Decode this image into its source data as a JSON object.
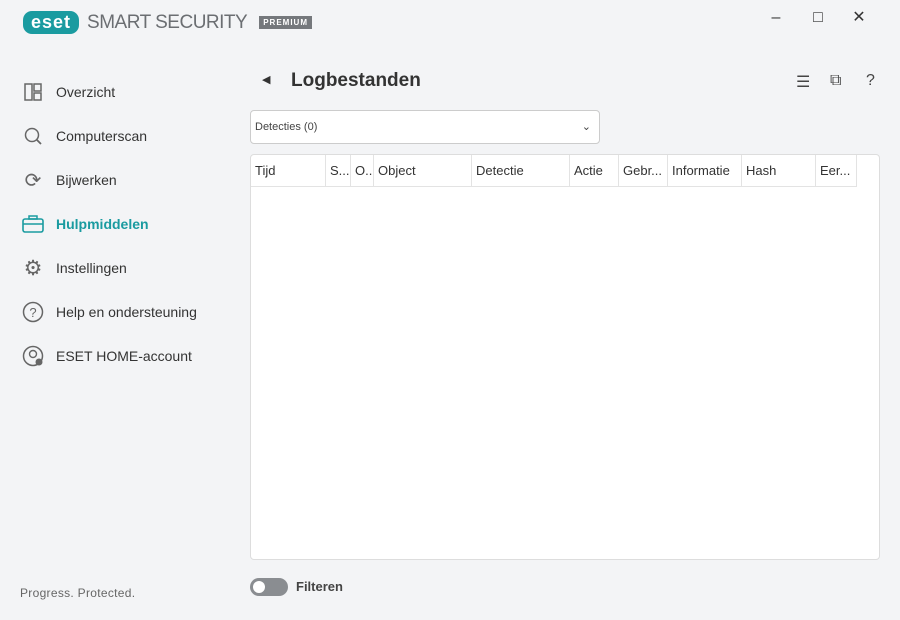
{
  "app": {
    "brand": "eset",
    "product": "SMART SECURITY",
    "edition": "PREMIUM",
    "tagline": "Progress. Protected."
  },
  "sidebar": {
    "items": [
      {
        "label": "Overzicht",
        "icon": "dashboard-icon"
      },
      {
        "label": "Computerscan",
        "icon": "search-icon"
      },
      {
        "label": "Bijwerken",
        "icon": "refresh-icon"
      },
      {
        "label": "Hulpmiddelen",
        "icon": "toolbox-icon",
        "active": true
      },
      {
        "label": "Instellingen",
        "icon": "gear-icon"
      },
      {
        "label": "Help en ondersteuning",
        "icon": "help-icon"
      },
      {
        "label": "ESET HOME-account",
        "icon": "account-icon"
      }
    ]
  },
  "page": {
    "title": "Logbestanden",
    "log_select": "Detecties (0)",
    "columns": [
      "Tijd",
      "S...",
      "O..",
      "Object",
      "Detectie",
      "Actie",
      "Gebr...",
      "Informatie",
      "Hash",
      "Eer..."
    ],
    "filter_label": "Filteren",
    "filter_on": false
  },
  "colors": {
    "accent": "#1a9ba0"
  }
}
